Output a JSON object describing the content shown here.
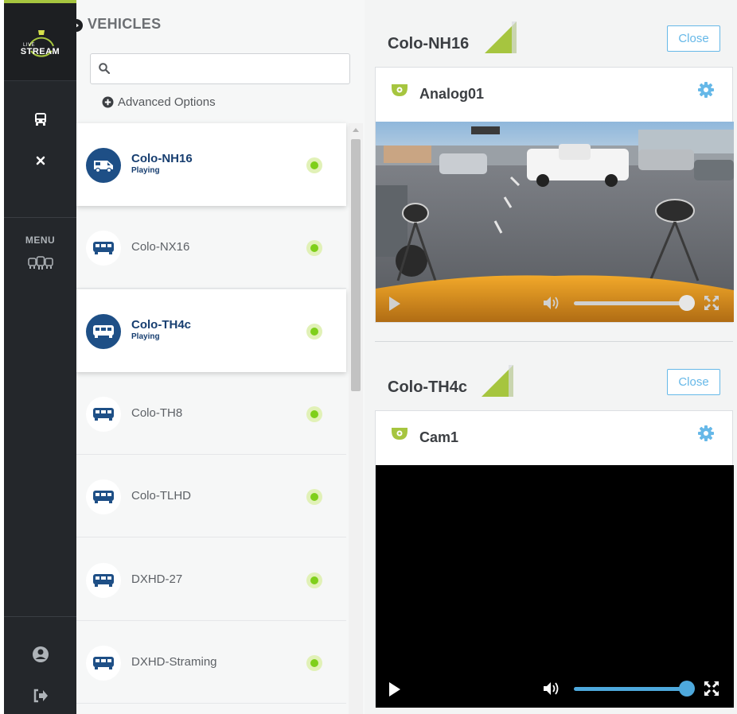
{
  "rail": {
    "logo_live": "LIVE",
    "logo_stream": "STREAM",
    "menu_label": "MENU",
    "accent_color": "#a6c53f"
  },
  "vehicles_panel": {
    "title": "VEHICLES",
    "search_placeholder": "",
    "advanced_options": "Advanced Options",
    "items": [
      {
        "name": "Colo-NH16",
        "status": "Playing",
        "active": true,
        "icon": "van-icon"
      },
      {
        "name": "Colo-NX16",
        "status": "",
        "active": false,
        "icon": "bus-icon"
      },
      {
        "name": "Colo-TH4c",
        "status": "Playing",
        "active": true,
        "icon": "bus-icon"
      },
      {
        "name": "Colo-TH8",
        "status": "",
        "active": false,
        "icon": "bus-icon"
      },
      {
        "name": "Colo-TLHD",
        "status": "",
        "active": false,
        "icon": "bus-icon"
      },
      {
        "name": "DXHD-27",
        "status": "",
        "active": false,
        "icon": "bus-icon"
      },
      {
        "name": "DXHD-Straming",
        "status": "",
        "active": false,
        "icon": "bus-icon"
      }
    ]
  },
  "streams": [
    {
      "vehicle": "Colo-NH16",
      "close_label": "Close",
      "camera": "Analog01",
      "has_video": true
    },
    {
      "vehicle": "Colo-TH4c",
      "close_label": "Close",
      "camera": "Cam1",
      "has_video": false
    }
  ],
  "colors": {
    "primary": "#1e4f86",
    "status_online": "#7fcf1b",
    "link_blue": "#66b8e8",
    "camera_green": "#a6c53f"
  }
}
